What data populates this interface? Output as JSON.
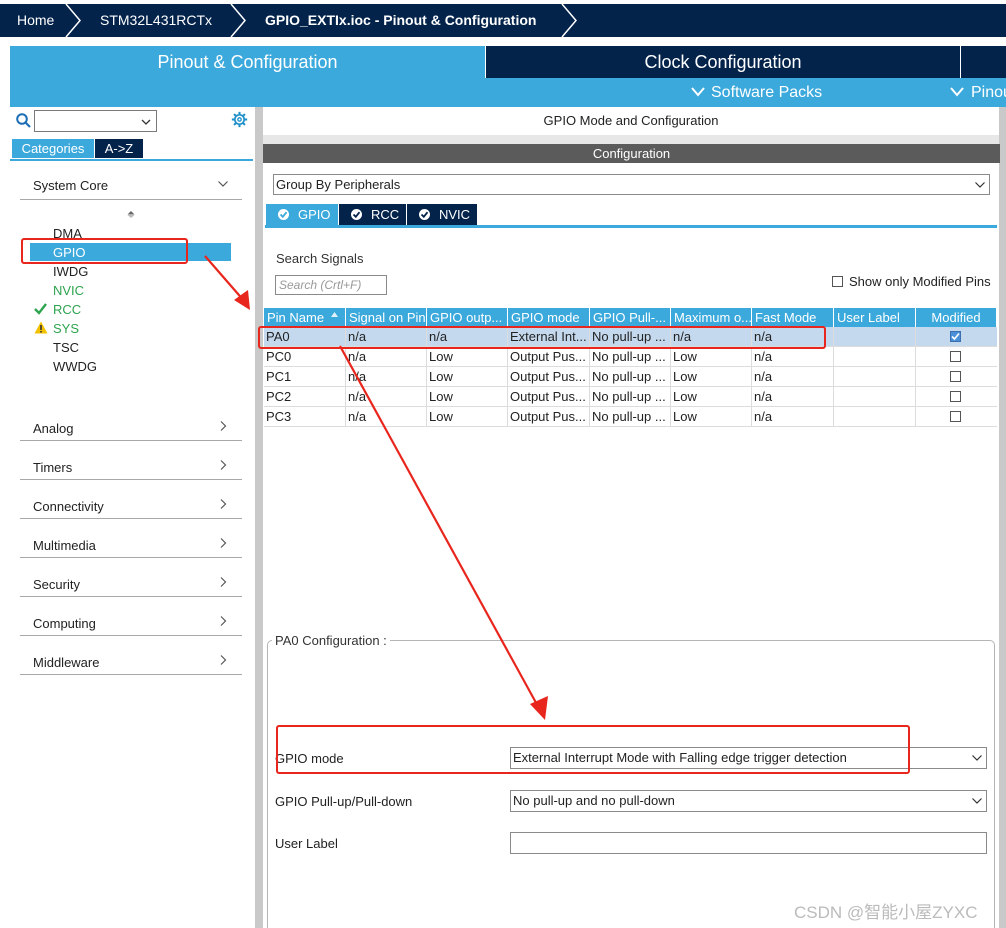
{
  "breadcrumb": {
    "items": [
      "Home",
      "STM32L431RCTx",
      "GPIO_EXTIx.ioc - Pinout & Configuration"
    ]
  },
  "main_tabs": {
    "pinout": "Pinout & Configuration",
    "clock": "Clock Configuration"
  },
  "subbar": {
    "software_packs": "Software Packs",
    "pinout": "Pinout"
  },
  "left": {
    "tabs": {
      "categories": "Categories",
      "az": "A->Z"
    },
    "system_core": {
      "label": "System Core",
      "items": [
        {
          "label": "DMA",
          "status": "none"
        },
        {
          "label": "GPIO",
          "status": "selected"
        },
        {
          "label": "IWDG",
          "status": "none"
        },
        {
          "label": "NVIC",
          "status": "configured"
        },
        {
          "label": "RCC",
          "status": "ok"
        },
        {
          "label": "SYS",
          "status": "warning"
        },
        {
          "label": "TSC",
          "status": "none"
        },
        {
          "label": "WWDG",
          "status": "none"
        }
      ]
    },
    "categories": [
      "Analog",
      "Timers",
      "Connectivity",
      "Multimedia",
      "Security",
      "Computing",
      "Middleware"
    ]
  },
  "right": {
    "title": "GPIO Mode and Configuration",
    "config_bar": "Configuration",
    "group_select": "Group By Peripherals",
    "tabs": [
      "GPIO",
      "RCC",
      "NVIC"
    ],
    "search_label": "Search Signals",
    "search_placeholder": "Search (Crtl+F)",
    "show_modified": "Show only Modified Pins",
    "table": {
      "columns": [
        "Pin Name",
        "Signal on Pin",
        "GPIO outp...",
        "GPIO mode",
        "GPIO Pull-...",
        "Maximum o...",
        "Fast Mode",
        "User Label",
        "Modified"
      ],
      "rows": [
        [
          "PA0",
          "n/a",
          "n/a",
          "External Int...",
          "No pull-up ...",
          "n/a",
          "n/a",
          "",
          true
        ],
        [
          "PC0",
          "n/a",
          "Low",
          "Output Pus...",
          "No pull-up ...",
          "Low",
          "n/a",
          "",
          false
        ],
        [
          "PC1",
          "n/a",
          "Low",
          "Output Pus...",
          "No pull-up ...",
          "Low",
          "n/a",
          "",
          false
        ],
        [
          "PC2",
          "n/a",
          "Low",
          "Output Pus...",
          "No pull-up ...",
          "Low",
          "n/a",
          "",
          false
        ],
        [
          "PC3",
          "n/a",
          "Low",
          "Output Pus...",
          "No pull-up ...",
          "Low",
          "n/a",
          "",
          false
        ]
      ]
    },
    "pa0_config": {
      "title": "PA0 Configuration :",
      "gpio_mode_label": "GPIO mode",
      "gpio_mode_value": "External Interrupt Mode with Falling edge trigger detection",
      "pull_label": "GPIO Pull-up/Pull-down",
      "pull_value": "No pull-up and no pull-down",
      "user_label": "User Label",
      "user_label_value": ""
    }
  },
  "watermark": "CSDN @智能小屋ZYXC",
  "colors": {
    "navy": "#03234b",
    "accent_blue": "#3ca9dc",
    "annotation_red": "#e8261d",
    "ok_green": "#2ea44f",
    "warn_yellow": "#f2c200"
  }
}
